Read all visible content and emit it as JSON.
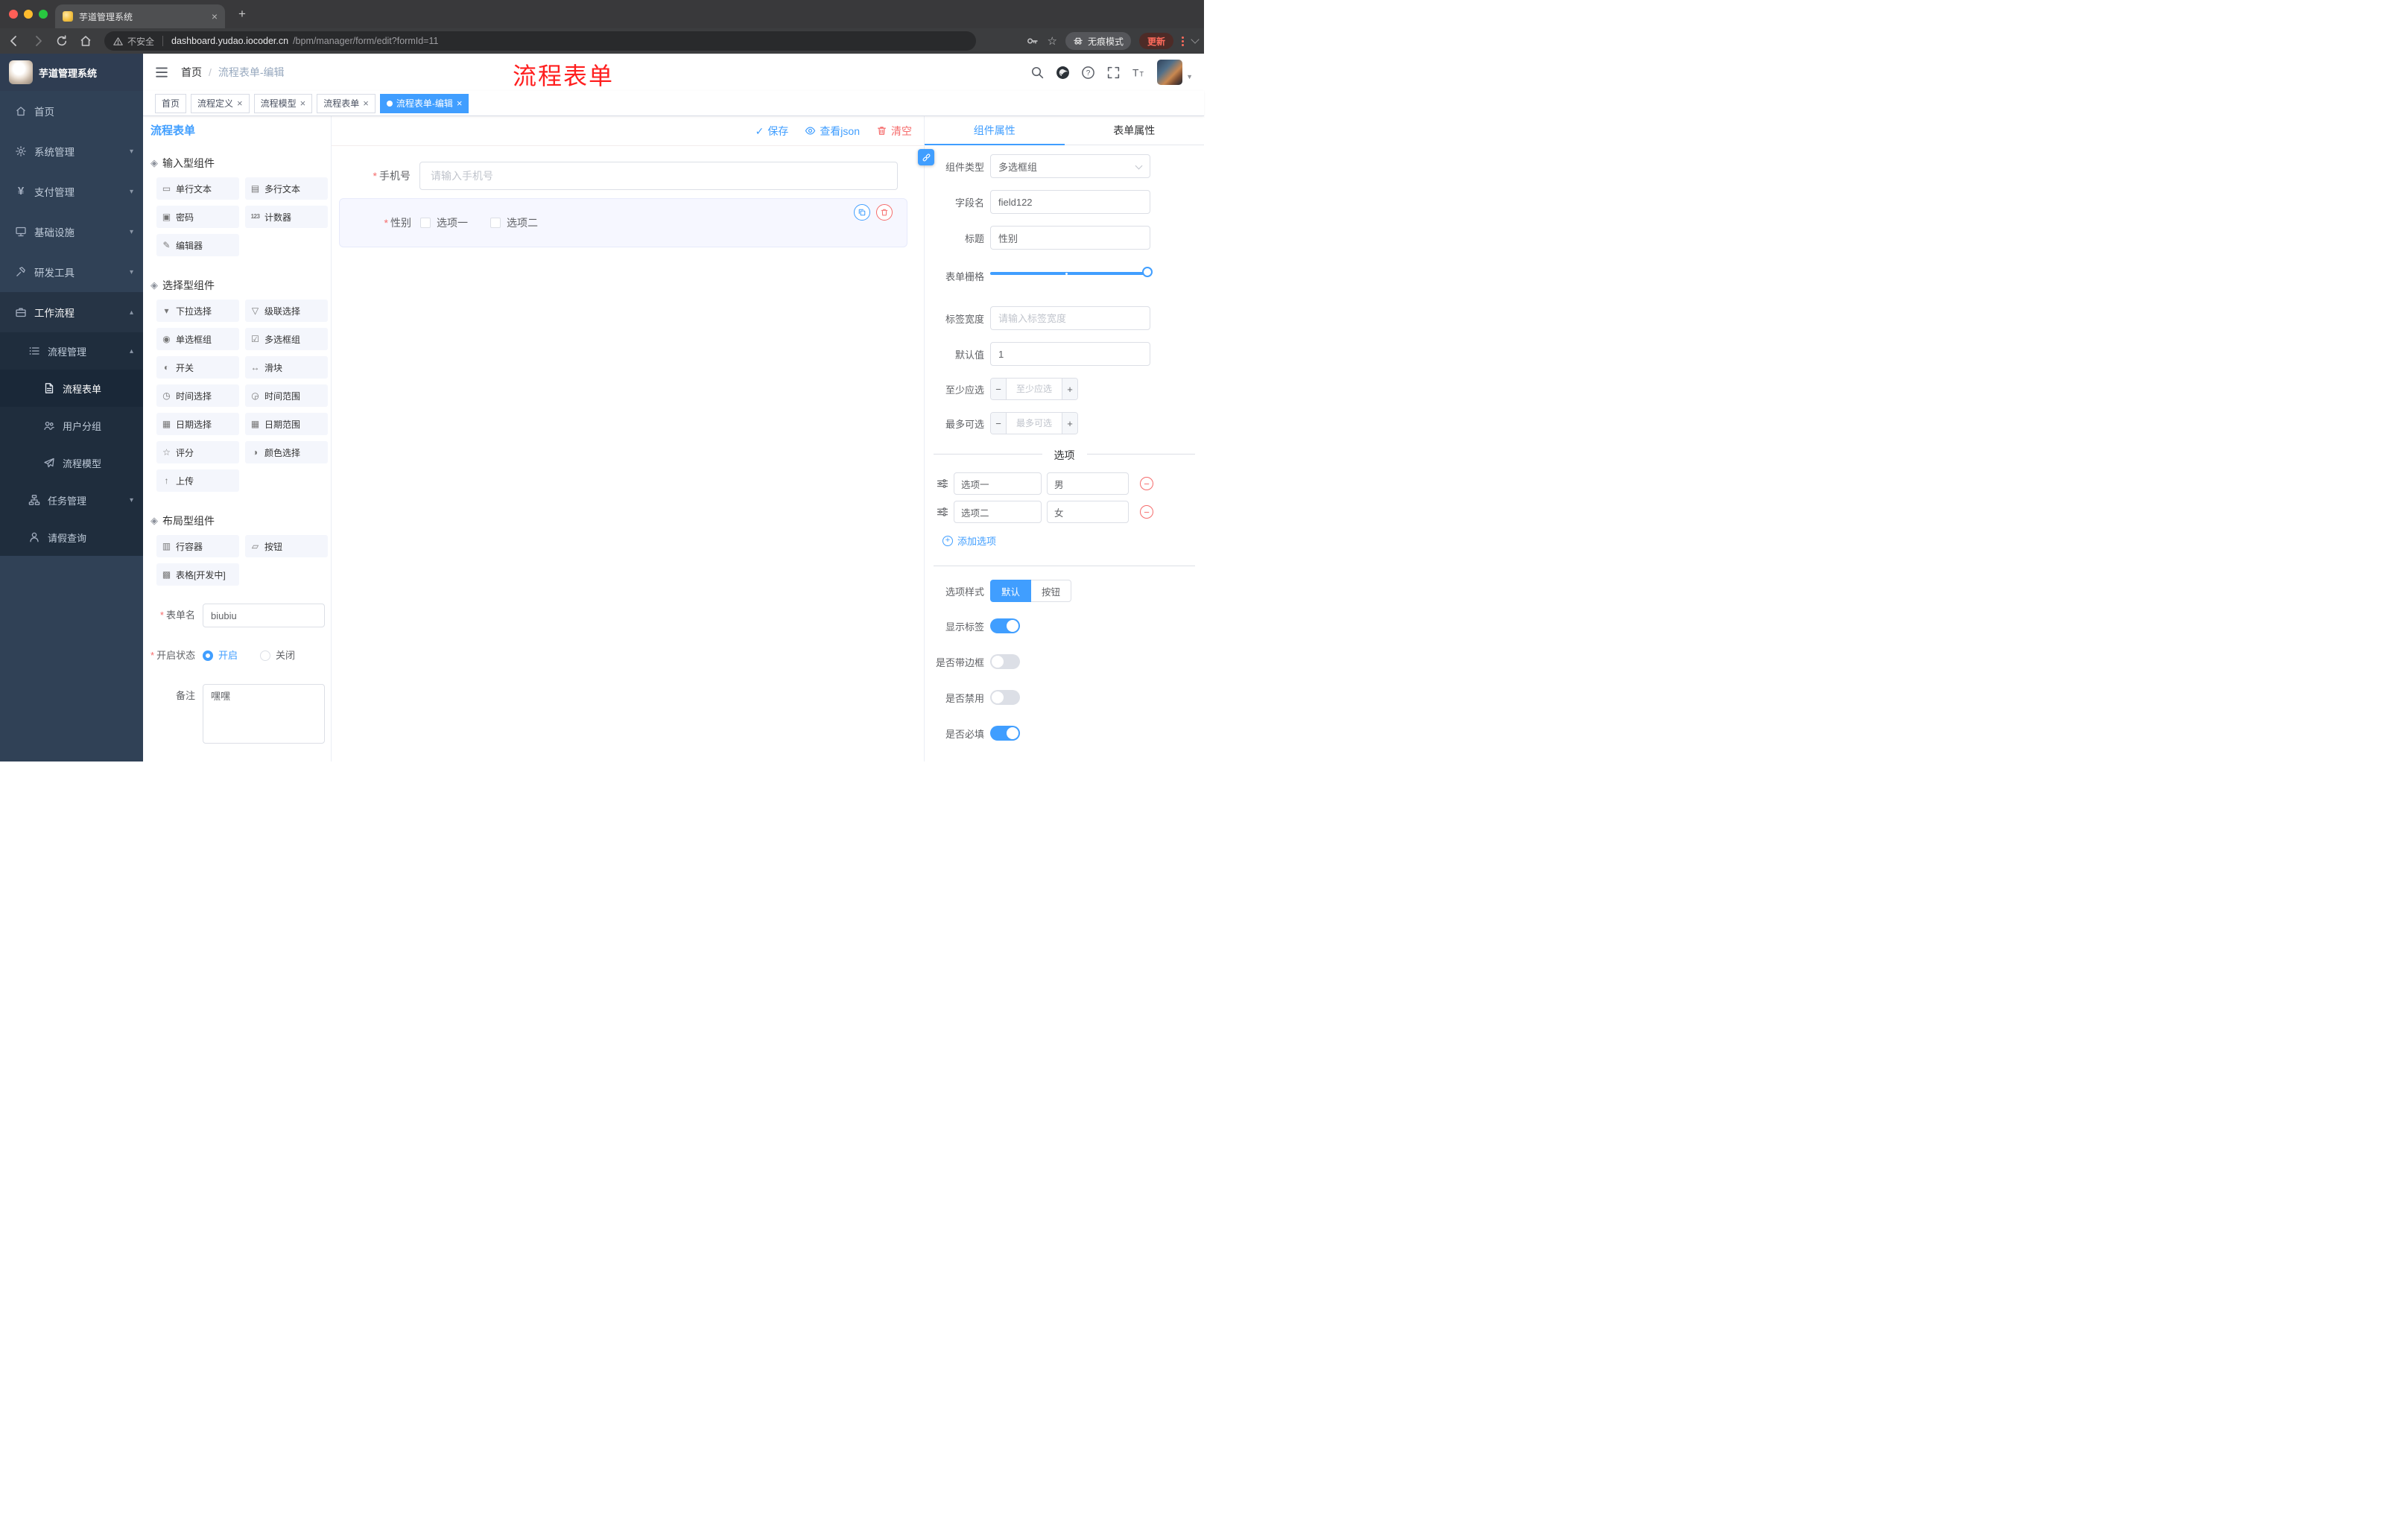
{
  "colors": {
    "accent": "#409eff",
    "danger": "#f56c6c",
    "sidebar_bg": "#304156",
    "submenu_bg": "#1f2d3d",
    "active_tag": "#409eff",
    "annotation": "#ff1f1f"
  },
  "browser": {
    "tab_title": "芋道管理系统",
    "security_label": "不安全",
    "url_domain": "dashboard.yudao.iocoder.cn",
    "url_path": "/bpm/manager/form/edit?formId=11",
    "incognito_label": "无痕模式",
    "update_label": "更新"
  },
  "sidebar": {
    "logo_title": "芋道管理系统",
    "menu": [
      {
        "label": "首页",
        "icon": "home-icon",
        "level": 1
      },
      {
        "label": "系统管理",
        "icon": "gear-icon",
        "level": 1,
        "expandable": true
      },
      {
        "label": "支付管理",
        "icon": "yen-icon",
        "level": 1,
        "expandable": true
      },
      {
        "label": "基础设施",
        "icon": "infrastructure-icon",
        "level": 1,
        "expandable": true
      },
      {
        "label": "研发工具",
        "icon": "devtools-icon",
        "level": 1,
        "expandable": true
      },
      {
        "label": "工作流程",
        "icon": "workflow-icon",
        "level": 1,
        "expandable": true,
        "expanded": true
      },
      {
        "label": "流程管理",
        "icon": "process-management-icon",
        "level": 2,
        "expandable": true,
        "expanded": true
      },
      {
        "label": "流程表单",
        "icon": "process-form-icon",
        "level": 3,
        "active": true
      },
      {
        "label": "用户分组",
        "icon": "user-group-icon",
        "level": 3
      },
      {
        "label": "流程模型",
        "icon": "process-model-icon",
        "level": 3
      },
      {
        "label": "任务管理",
        "icon": "task-management-icon",
        "level": 2,
        "expandable": true
      },
      {
        "label": "请假查询",
        "icon": "leave-query-icon",
        "level": 2
      }
    ]
  },
  "header": {
    "breadcrumb_home": "首页",
    "breadcrumb_separator": "/",
    "breadcrumb_current": "流程表单-编辑",
    "annotation": "流程表单"
  },
  "tags": [
    {
      "label": "首页",
      "active": false,
      "closable": false
    },
    {
      "label": "流程定义",
      "active": false,
      "closable": true
    },
    {
      "label": "流程模型",
      "active": false,
      "closable": true
    },
    {
      "label": "流程表单",
      "active": false,
      "closable": true
    },
    {
      "label": "流程表单-编辑",
      "active": true,
      "closable": true
    }
  ],
  "designer": {
    "title": "流程表单",
    "actions": {
      "save": "保存",
      "view_json": "查看json",
      "clear": "清空"
    },
    "palette": {
      "sections": [
        {
          "title": "输入型组件",
          "items": [
            {
              "label": "单行文本",
              "icon": "single-line-text-icon"
            },
            {
              "label": "多行文本",
              "icon": "multi-line-text-icon"
            },
            {
              "label": "密码",
              "icon": "password-icon"
            },
            {
              "label": "计数器",
              "icon": "counter-icon"
            },
            {
              "label": "编辑器",
              "icon": "editor-icon"
            }
          ]
        },
        {
          "title": "选择型组件",
          "items": [
            {
              "label": "下拉选择",
              "icon": "select-icon"
            },
            {
              "label": "级联选择",
              "icon": "cascader-icon"
            },
            {
              "label": "单选框组",
              "icon": "radio-group-icon"
            },
            {
              "label": "多选框组",
              "icon": "checkbox-group-icon"
            },
            {
              "label": "开关",
              "icon": "switch-icon"
            },
            {
              "label": "滑块",
              "icon": "slider-icon"
            },
            {
              "label": "时间选择",
              "icon": "time-picker-icon"
            },
            {
              "label": "时间范围",
              "icon": "time-range-icon"
            },
            {
              "label": "日期选择",
              "icon": "date-picker-icon"
            },
            {
              "label": "日期范围",
              "icon": "date-range-icon"
            },
            {
              "label": "评分",
              "icon": "rate-icon"
            },
            {
              "label": "颜色选择",
              "icon": "color-picker-icon"
            },
            {
              "label": "上传",
              "icon": "upload-icon"
            }
          ]
        },
        {
          "title": "布局型组件",
          "items": [
            {
              "label": "行容器",
              "icon": "row-container-icon"
            },
            {
              "label": "按钮",
              "icon": "button-icon"
            },
            {
              "label": "表格[开发中]",
              "icon": "table-icon"
            }
          ]
        }
      ]
    },
    "meta": {
      "form_name_label": "表单名",
      "form_name_value": "biubiu",
      "status_label": "开启状态",
      "status_on": "开启",
      "status_off": "关闭",
      "status_selected": "开启",
      "remark_label": "备注",
      "remark_value": "嘿嘿"
    },
    "canvas": {
      "phone": {
        "label": "手机号",
        "required": true,
        "placeholder": "请输入手机号"
      },
      "gender": {
        "label": "性别",
        "required": true,
        "option1": "选项一",
        "option2": "选项二",
        "selected": true
      }
    },
    "props": {
      "tab_component": "组件属性",
      "tab_form": "表单属性",
      "component_type_label": "组件类型",
      "component_type_value": "多选框组",
      "field_name_label": "字段名",
      "field_name_value": "field122",
      "title_label": "标题",
      "title_value": "性别",
      "grid_label": "表单栅格",
      "label_width_label": "标签宽度",
      "label_width_placeholder": "请输入标签宽度",
      "default_label": "默认值",
      "default_value": "1",
      "min_label": "至少应选",
      "min_placeholder": "至少应选",
      "max_label": "最多可选",
      "max_placeholder": "最多可选",
      "options_title": "选项",
      "options": [
        {
          "label": "选项一",
          "value": "男"
        },
        {
          "label": "选项二",
          "value": "女"
        }
      ],
      "add_option": "添加选项",
      "style_label": "选项样式",
      "style_default": "默认",
      "style_button": "按钮",
      "style_selected": "默认",
      "toggles": [
        {
          "label": "显示标签",
          "on": true
        },
        {
          "label": "是否带边框",
          "on": false
        },
        {
          "label": "是否禁用",
          "on": false
        },
        {
          "label": "是否必填",
          "on": true
        }
      ]
    }
  }
}
